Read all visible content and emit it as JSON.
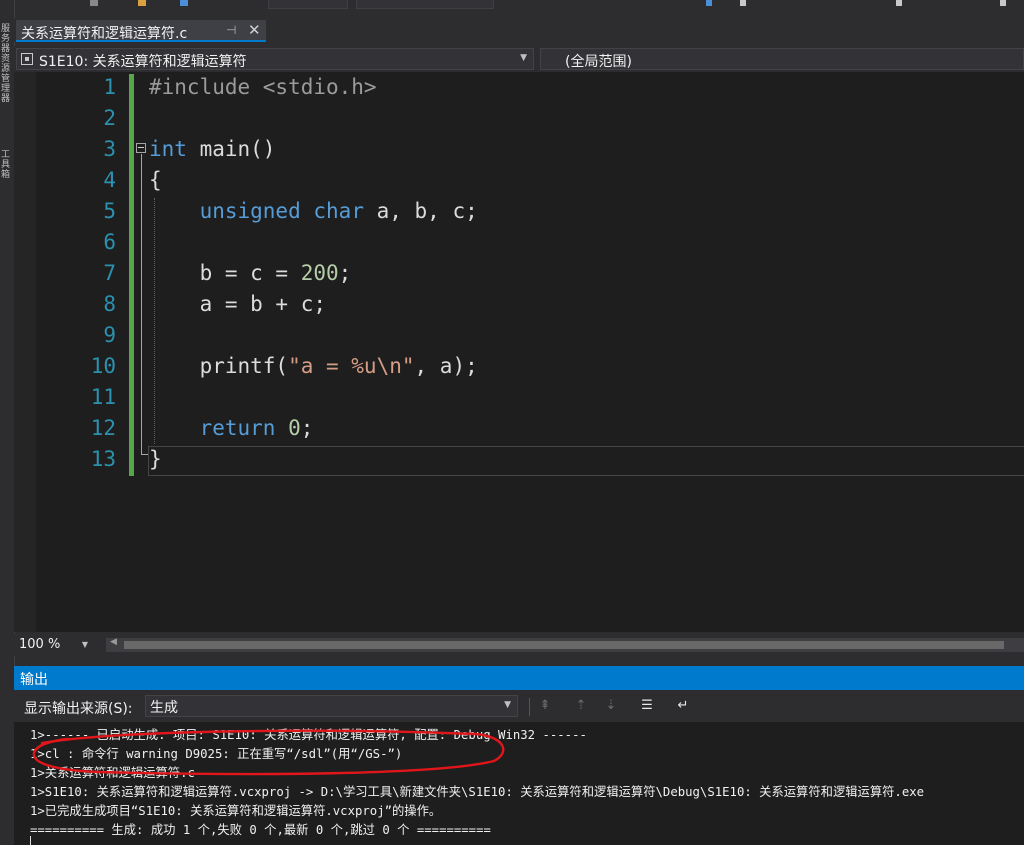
{
  "doc_tab": {
    "title": "关系运算符和逻辑运算符.c",
    "pin": "⊣",
    "close": "✕"
  },
  "left_strip": {
    "labels": [
      "服务器资源管理器",
      "工具箱"
    ]
  },
  "nav": {
    "project_scope": "S1E10: 关系运算符和逻辑运算符",
    "member_scope": "(全局范围)"
  },
  "editor": {
    "line_numbers": [
      "1",
      "2",
      "3",
      "4",
      "5",
      "6",
      "7",
      "8",
      "9",
      "10",
      "11",
      "12",
      "13"
    ],
    "lines": [
      [
        {
          "t": "#include <stdio.h>",
          "c": "pp"
        }
      ],
      [],
      [
        {
          "t": "int",
          "c": "kw"
        },
        {
          "t": " main()",
          "c": ""
        }
      ],
      [
        {
          "t": "{",
          "c": ""
        }
      ],
      [
        {
          "t": "    ",
          "c": ""
        },
        {
          "t": "unsigned",
          "c": "kw"
        },
        {
          "t": " ",
          "c": ""
        },
        {
          "t": "char",
          "c": "kw"
        },
        {
          "t": " a, b, c;",
          "c": ""
        }
      ],
      [],
      [
        {
          "t": "    b = c = ",
          "c": ""
        },
        {
          "t": "200",
          "c": "num"
        },
        {
          "t": ";",
          "c": ""
        }
      ],
      [
        {
          "t": "    a = b + c;",
          "c": ""
        }
      ],
      [],
      [
        {
          "t": "    printf(",
          "c": ""
        },
        {
          "t": "\"a = %u\\n\"",
          "c": "str"
        },
        {
          "t": ", a);",
          "c": ""
        }
      ],
      [],
      [
        {
          "t": "    ",
          "c": ""
        },
        {
          "t": "return",
          "c": "kw"
        },
        {
          "t": " ",
          "c": ""
        },
        {
          "t": "0",
          "c": "num"
        },
        {
          "t": ";",
          "c": ""
        }
      ],
      [
        {
          "t": "}",
          "c": ""
        }
      ]
    ]
  },
  "zoom": {
    "value": "100 %"
  },
  "output": {
    "title": "输出",
    "source_label": "显示输出来源(S):",
    "source_value": "生成",
    "lines": [
      "1>------ 已启动生成: 项目: S1E10: 关系运算符和逻辑运算符, 配置: Debug Win32 ------",
      "1>cl : 命令行 warning D9025: 正在重写“/sdl”(用“/GS-”)",
      "1>关系运算符和逻辑运算符.c",
      "1>S1E10: 关系运算符和逻辑运算符.vcxproj -> D:\\学习工具\\新建文件夹\\S1E10: 关系运算符和逻辑运算符\\Debug\\S1E10: 关系运算符和逻辑运算符.exe",
      "1>已完成生成项目“S1E10: 关系运算符和逻辑运算符.vcxproj”的操作。",
      "========== 生成: 成功 1 个,失败 0 个,最新 0 个,跳过 0 个 =========="
    ]
  },
  "colors": {
    "accent": "#007acc",
    "keyword": "#569cd6",
    "line_number": "#2b91af",
    "string": "#d69d85",
    "number": "#b5cea8",
    "annotation": "#e0161b",
    "changed_bar": "#57a64a"
  }
}
